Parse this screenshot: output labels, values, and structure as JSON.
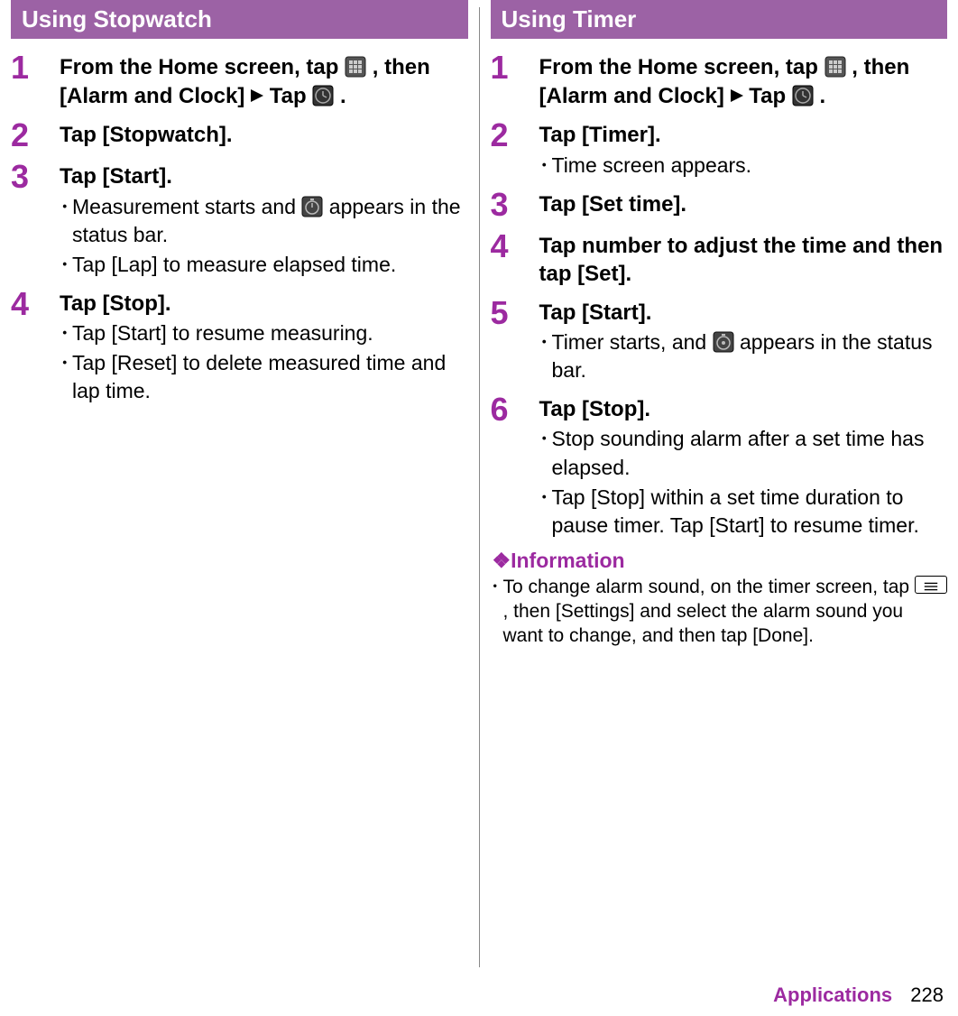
{
  "left": {
    "title": "Using Stopwatch",
    "steps": [
      {
        "num": "1",
        "main_parts": [
          "From the Home screen, tap ",
          " , then [Alarm and Clock]",
          "Tap ",
          " ."
        ]
      },
      {
        "num": "2",
        "main": "Tap [Stopwatch]."
      },
      {
        "num": "3",
        "main": "Tap [Start].",
        "subs_parts": [
          [
            "Measurement starts and ",
            " appears in the status bar."
          ],
          [
            "Tap [Lap] to measure elapsed time."
          ]
        ]
      },
      {
        "num": "4",
        "main": "Tap [Stop].",
        "subs": [
          "Tap [Start] to resume measuring.",
          "Tap [Reset] to delete measured time and lap time."
        ]
      }
    ]
  },
  "right": {
    "title": "Using Timer",
    "steps": [
      {
        "num": "1",
        "main_parts": [
          "From the Home screen, tap ",
          " , then [Alarm and Clock]",
          "Tap ",
          " ."
        ]
      },
      {
        "num": "2",
        "main": "Tap [Timer].",
        "subs": [
          "Time screen appears."
        ]
      },
      {
        "num": "3",
        "main": "Tap [Set time]."
      },
      {
        "num": "4",
        "main": "Tap number to adjust the time and then tap [Set]."
      },
      {
        "num": "5",
        "main": "Tap [Start].",
        "subs_parts": [
          [
            "Timer starts, and ",
            " appears in the status bar."
          ]
        ]
      },
      {
        "num": "6",
        "main": "Tap [Stop].",
        "subs": [
          "Stop sounding alarm after a set time has elapsed.",
          "Tap [Stop] within a set time duration to pause timer. Tap [Start] to resume timer."
        ]
      }
    ],
    "info_head": "❖Information",
    "info_sub_parts": [
      "To change alarm sound, on the timer screen, tap ",
      " , then [Settings] and select the alarm sound you want to change, and then tap [Done]."
    ]
  },
  "footer": {
    "section": "Applications",
    "page": "228"
  }
}
